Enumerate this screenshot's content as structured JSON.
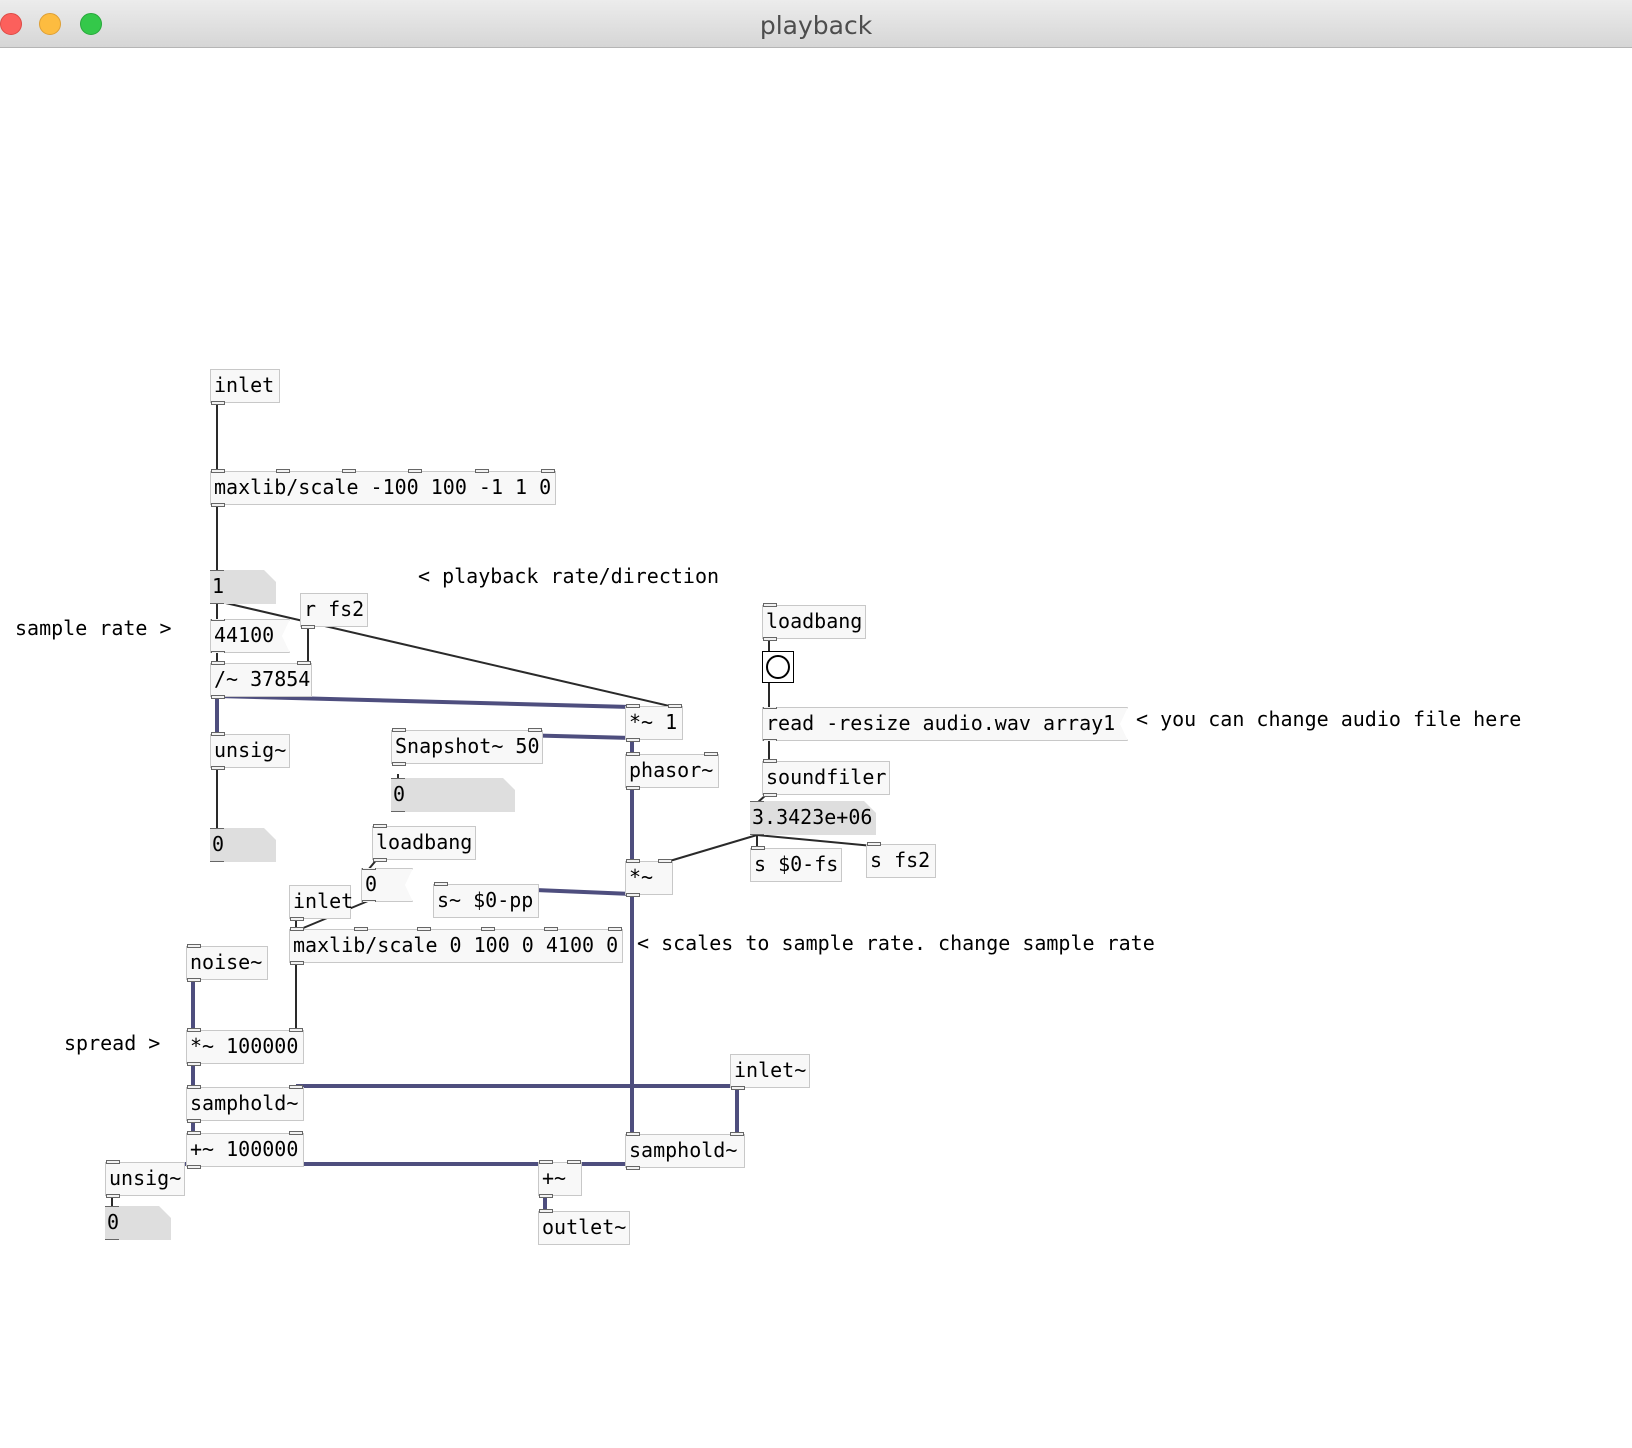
{
  "window": {
    "title": "playback"
  },
  "objects": {
    "inlet_top": "inlet",
    "scale_rate": "maxlib/scale -100 100 -1 1 0",
    "r_fs2": "r fs2",
    "div_sig": "/~ 37854",
    "mul_1": "*~ 1",
    "unsig_1": "unsig~",
    "snapshot": "Snapshot~ 50",
    "phasor": "phasor~",
    "loadbang_right": "loadbang",
    "soundfiler": "soundfiler",
    "s_fs": "s $0-fs",
    "s_fs2": "s fs2",
    "mul_pp": "*~",
    "loadbang_mid": "loadbang",
    "inlet_mid": "inlet",
    "s_pp": "s~ $0-pp",
    "scale_sr": "maxlib/scale 0 100 0 4100 0",
    "noise": "noise~",
    "mul_spread": "*~ 100000",
    "samphold_1": "samphold~",
    "inlet_sig": "inlet~",
    "add_offset": "+~ 100000",
    "samphold_2": "samphold~",
    "unsig_2": "unsig~",
    "add_sig": "+~",
    "outlet": "outlet~"
  },
  "messages": {
    "read": "read -resize audio.wav array1",
    "sample_rate": "44100",
    "zero_init": "0"
  },
  "number_boxes": {
    "rate": "1",
    "snapshot_out": "0",
    "unsig_out": "0",
    "file_length": "3.3423e+06",
    "unsig2_out": "0"
  },
  "comments": {
    "rate_dir": "< playback rate/direction",
    "sample_rate": "sample rate >",
    "change_file": "< you can change audio file here",
    "scales": "< scales to sample rate. change sample rate",
    "spread": "spread >"
  },
  "colors": {
    "signal_wire": "#4e4e7e",
    "control_wire": "#2a2a2a",
    "box_border": "#c8c8c8",
    "number_fill": "#dedede"
  }
}
